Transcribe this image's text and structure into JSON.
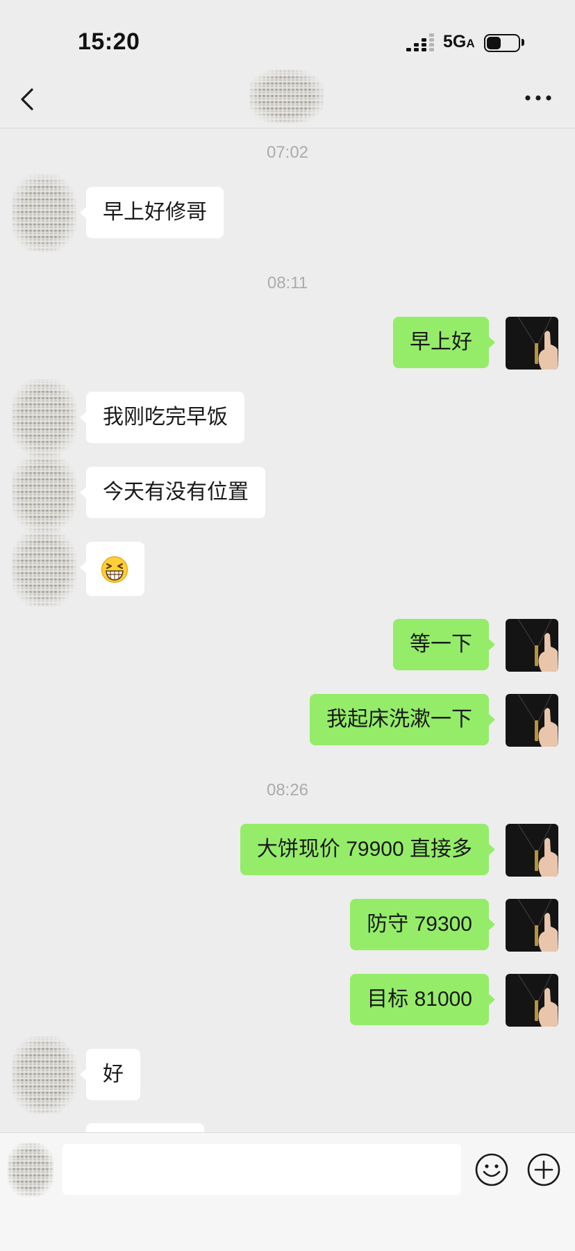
{
  "status_bar": {
    "time": "15:20",
    "network": "5G",
    "network_suffix": "A",
    "battery_level": 0.45,
    "signal_bars_filled": 3,
    "signal_bars_total": 4
  },
  "header": {
    "back_icon": "chevron-left-icon",
    "more_icon": "more-dots-icon"
  },
  "timestamps": [
    "07:02",
    "08:11",
    "08:26"
  ],
  "messages": [
    {
      "side": "left",
      "text": "早上好修哥"
    },
    {
      "side": "right",
      "text": "早上好"
    },
    {
      "side": "left",
      "text": "我刚吃完早饭"
    },
    {
      "side": "left",
      "text": "今天有没有位置"
    },
    {
      "side": "left",
      "type": "emoji",
      "emoji": "beaming-face-icon"
    },
    {
      "side": "right",
      "text": "等一下"
    },
    {
      "side": "right",
      "text": "我起床洗漱一下"
    },
    {
      "side": "right",
      "text": "大饼现价 79900 直接多"
    },
    {
      "side": "right",
      "text": "防守 79300"
    },
    {
      "side": "right",
      "text": "目标 81000"
    },
    {
      "side": "left",
      "text": "好"
    }
  ],
  "input_bar": {
    "value": "",
    "voice_icon": "voice-icon",
    "emoji_icon": "emoji-icon",
    "plus_icon": "plus-icon"
  },
  "colors": {
    "background": "#ededed",
    "left_bubble": "#ffffff",
    "right_bubble": "#95ec69",
    "timestamp": "#ababab"
  }
}
